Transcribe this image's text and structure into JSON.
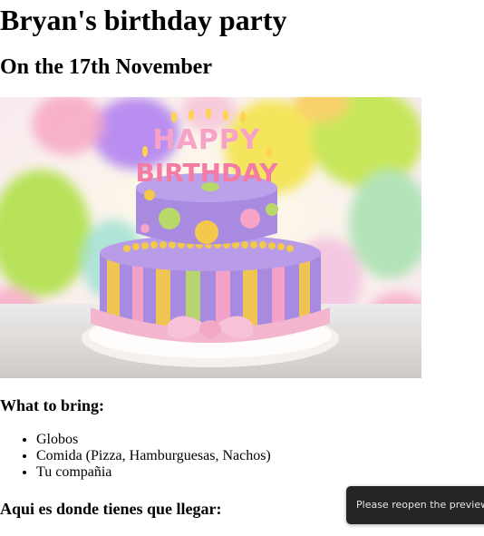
{
  "page": {
    "title": "Bryan's birthday party",
    "subtitle": "On the 17th November"
  },
  "image": {
    "cake_text_top": "HAPPY",
    "cake_text_bottom": "BIRTHDAY"
  },
  "bring": {
    "heading": "What to bring:",
    "items": [
      "Globos",
      "Comida (Pizza, Hamburguesas, Nachos)",
      "Tu compañia"
    ]
  },
  "directions": {
    "heading": "Aqui es donde tienes que llegar:"
  },
  "toast": {
    "message": "Please reopen the preview."
  },
  "colors": {
    "cake_purple": "#a88be0",
    "cake_yellow": "#f3c84b",
    "ribbon_pink": "#f4b6cf",
    "toast_bg": "#252526"
  }
}
